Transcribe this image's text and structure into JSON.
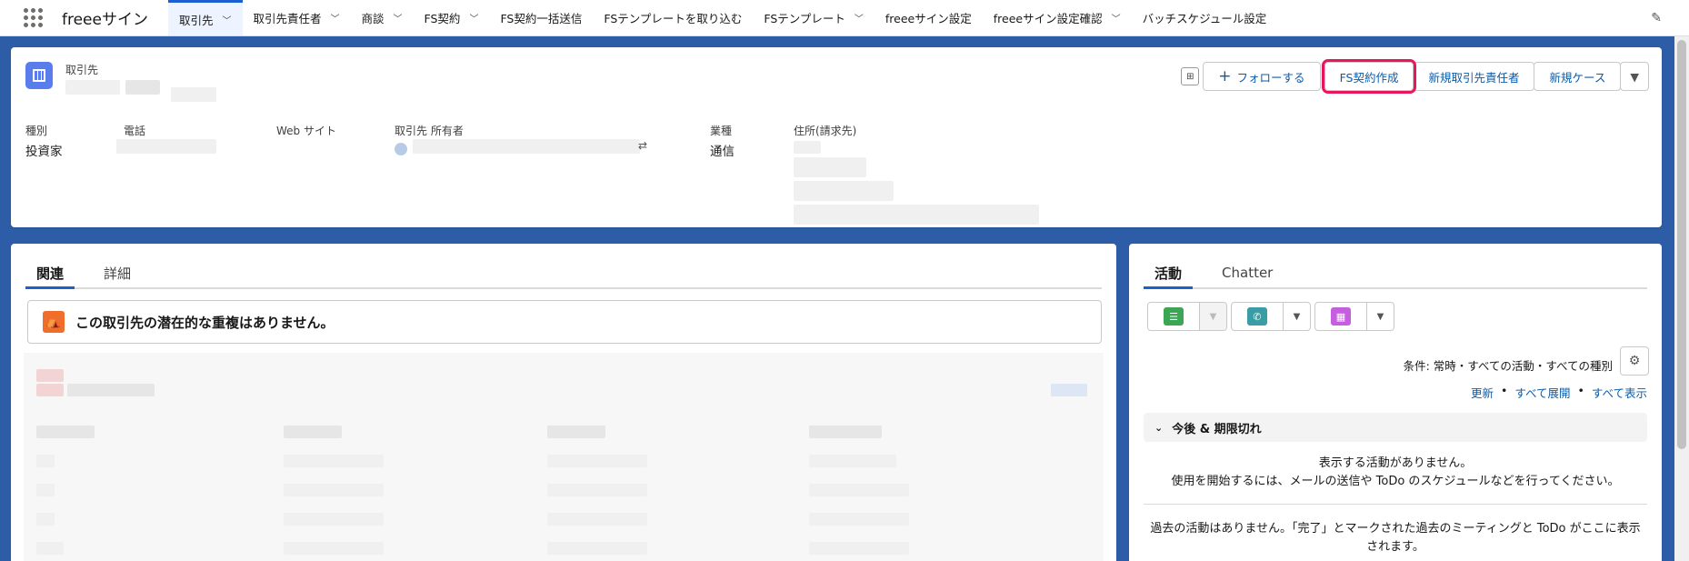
{
  "nav": {
    "app_name": "freeeサイン",
    "tabs": [
      {
        "label": "取引先",
        "has_menu": true,
        "active": true
      },
      {
        "label": "取引先責任者",
        "has_menu": true
      },
      {
        "label": "商談",
        "has_menu": true
      },
      {
        "label": "FS契約",
        "has_menu": true
      },
      {
        "label": "FS契約一括送信",
        "has_menu": false
      },
      {
        "label": "FSテンプレートを取り込む",
        "has_menu": false
      },
      {
        "label": "FSテンプレート",
        "has_menu": true
      },
      {
        "label": "freeeサイン設定",
        "has_menu": false
      },
      {
        "label": "freeeサイン設定確認",
        "has_menu": true
      },
      {
        "label": "バッチスケジュール設定",
        "has_menu": false
      }
    ],
    "icons": {
      "waffle": "app-launcher-icon",
      "edit": "pencil-icon",
      "chevron": "chevron-down-icon"
    }
  },
  "record": {
    "object_type": "取引先",
    "actions": {
      "follow": "フォローする",
      "fs_contract": "FS契約作成",
      "new_contact": "新規取引先責任者",
      "new_case": "新規ケース"
    },
    "fields": {
      "type_label": "種別",
      "type_value": "投資家",
      "phone_label": "電話",
      "website_label": "Web サイト",
      "owner_label": "取引先 所有者",
      "industry_label": "業種",
      "industry_value": "通信",
      "address_label": "住所(請求先)"
    },
    "highlight_color": "#e8175d"
  },
  "related": {
    "tabs": [
      "関連",
      "詳細"
    ],
    "duplicate_message": "この取引先の潜在的な重複はありません。"
  },
  "activity": {
    "tabs": [
      "活動",
      "Chatter"
    ],
    "filter_text": "条件: 常時・すべての活動・すべての種別",
    "links": [
      "更新",
      "すべて展開",
      "すべて表示"
    ],
    "upcoming_title": "今後 & 期限切れ",
    "empty_line1": "表示する活動がありません。",
    "empty_line2": "使用を開始するには、メールの送信や ToDo のスケジュールなどを行ってください。",
    "past_line1": "過去の活動はありません。「完了」とマークされた過去のミーティングと ToDo がここに表示",
    "past_line2": "されます。"
  }
}
